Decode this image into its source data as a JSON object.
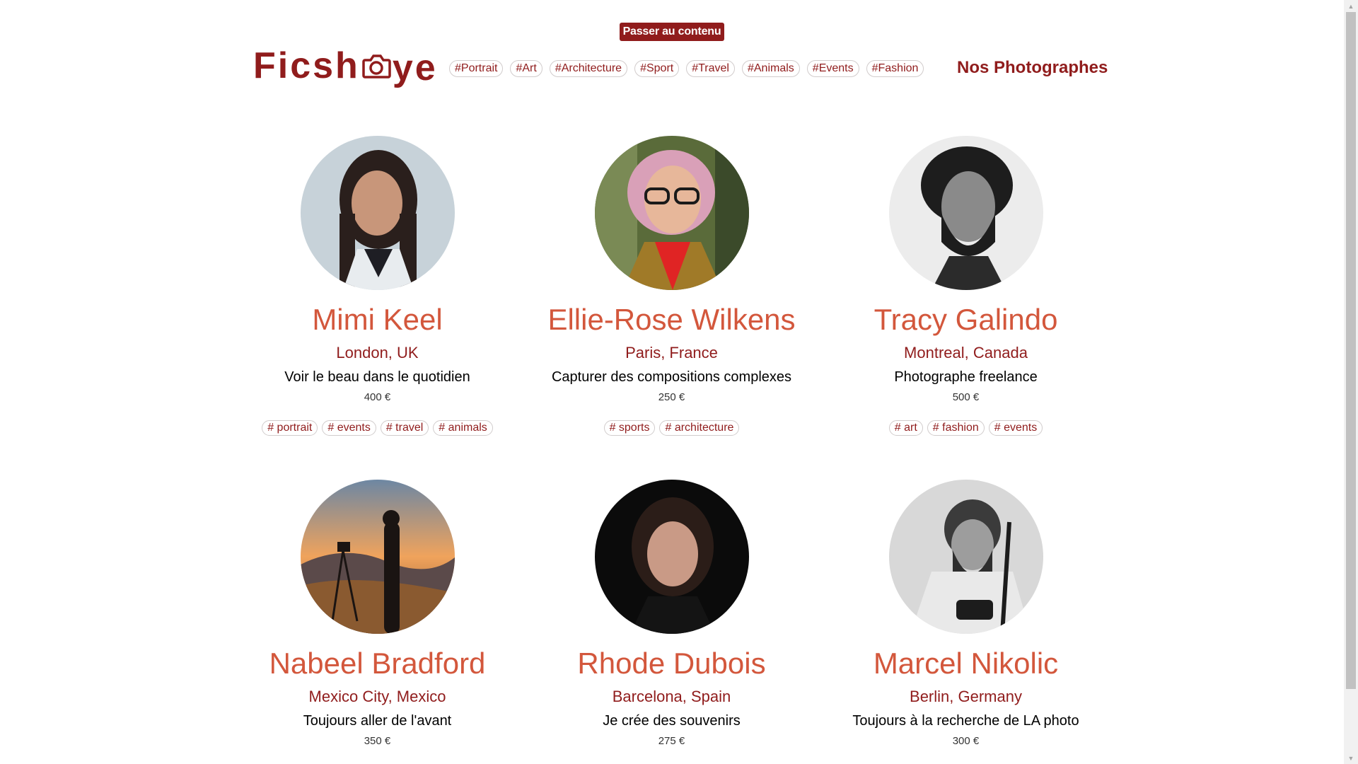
{
  "skip_link": "Passer au contenu",
  "logo": {
    "part1": "Ficsh",
    "part2": "ye",
    "icon": "camera-icon"
  },
  "nav": {
    "tags": [
      "#Portrait",
      "#Art",
      "#Architecture",
      "#Sport",
      "#Travel",
      "#Animals",
      "#Events",
      "#Fashion"
    ],
    "title": "Nos Photographes"
  },
  "photographers": [
    {
      "name": "Mimi Keel",
      "location": "London, UK",
      "tagline": "Voir le beau dans le quotidien",
      "price": "400 €",
      "tags": [
        "# portrait",
        "# events",
        "# travel",
        "# animals"
      ]
    },
    {
      "name": "Ellie-Rose Wilkens",
      "location": "Paris, France",
      "tagline": "Capturer des compositions complexes",
      "price": "250 €",
      "tags": [
        "# sports",
        "# architecture"
      ]
    },
    {
      "name": "Tracy Galindo",
      "location": "Montreal, Canada",
      "tagline": "Photographe freelance",
      "price": "500 €",
      "tags": [
        "# art",
        "# fashion",
        "# events"
      ]
    },
    {
      "name": "Nabeel Bradford",
      "location": "Mexico City, Mexico",
      "tagline": "Toujours aller de l'avant",
      "price": "350 €",
      "tags": []
    },
    {
      "name": "Rhode Dubois",
      "location": "Barcelona, Spain",
      "tagline": "Je crée des souvenirs",
      "price": "275 €",
      "tags": []
    },
    {
      "name": "Marcel Nikolic",
      "location": "Berlin, Germany",
      "tagline": "Toujours à la recherche de LA photo",
      "price": "300 €",
      "tags": []
    }
  ],
  "colors": {
    "brand": "#901c1c",
    "name": "#d3573c"
  }
}
